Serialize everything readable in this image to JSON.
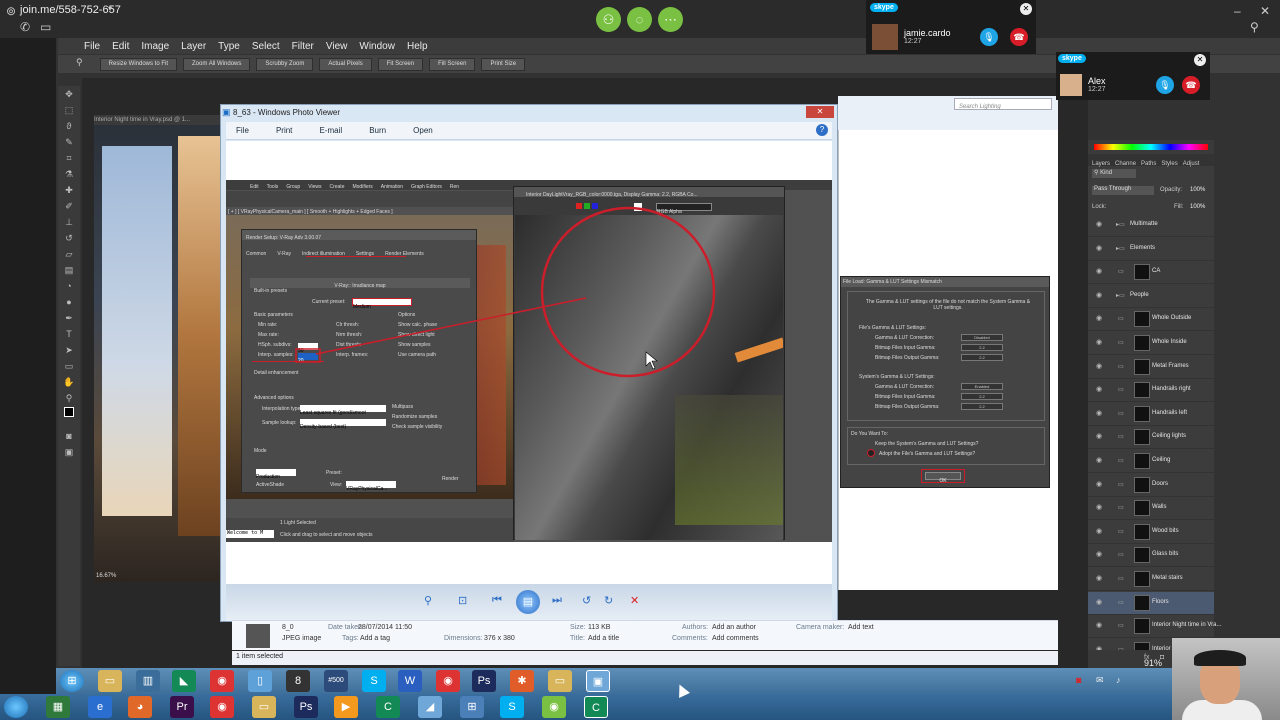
{
  "joinme": {
    "url": "join.me/558-752-657"
  },
  "photoshop": {
    "logo": "Ps",
    "menu": [
      "File",
      "Edit",
      "Image",
      "Layer",
      "Type",
      "Select",
      "Filter",
      "View",
      "Window",
      "Help"
    ],
    "options": [
      "Resize Windows to Fit",
      "Zoom All Windows",
      "Scrubby Zoom",
      "Actual Pixels",
      "Fit Screen",
      "Fill Screen",
      "Print Size"
    ],
    "doc_title": "Interior Night time in Vray.psd @ 1...",
    "zoom": "16.67%",
    "search_placeholder": "Search Lighting",
    "panel_tabs": [
      "Layers",
      "Channe",
      "Paths",
      "Styles",
      "Adjust"
    ],
    "kind_label": "Kind",
    "blend_mode": "Pass Through",
    "opacity_label": "Opacity:",
    "opacity_value": "100%",
    "lock_label": "Lock:",
    "fill_label": "Fill:",
    "fill_value": "100%",
    "layers": [
      {
        "name": "Multimatte",
        "folder": true,
        "selected": false
      },
      {
        "name": "Elements",
        "folder": true,
        "selected": false
      },
      {
        "name": "CA",
        "folder": false,
        "selected": false
      },
      {
        "name": "People",
        "folder": true,
        "selected": false
      },
      {
        "name": "Whole Outside",
        "folder": false,
        "selected": false
      },
      {
        "name": "Whole Inside",
        "folder": false,
        "selected": false
      },
      {
        "name": "Metal Frames",
        "folder": false,
        "selected": false
      },
      {
        "name": "Handrails right",
        "folder": false,
        "selected": false
      },
      {
        "name": "Handrails left",
        "folder": false,
        "selected": false
      },
      {
        "name": "Ceiling lights",
        "folder": false,
        "selected": false
      },
      {
        "name": "Ceiling",
        "folder": false,
        "selected": false
      },
      {
        "name": "Doors",
        "folder": false,
        "selected": false
      },
      {
        "name": "Walls",
        "folder": false,
        "selected": false
      },
      {
        "name": "Wood bits",
        "folder": false,
        "selected": false
      },
      {
        "name": "Glass bits",
        "folder": false,
        "selected": false
      },
      {
        "name": "Metal stairs",
        "folder": false,
        "selected": false
      },
      {
        "name": "Floors",
        "folder": false,
        "selected": true
      },
      {
        "name": "Interior Night time in Vra...",
        "folder": false,
        "selected": false
      },
      {
        "name": "Interior Night time in Vra...",
        "folder": false,
        "selected": false
      }
    ],
    "zoom_readout": "91%"
  },
  "photo_viewer": {
    "title": "8_63 - Windows Photo Viewer",
    "menu": [
      "File",
      "Print",
      "E-mail",
      "Burn",
      "Open"
    ]
  },
  "max": {
    "menu": [
      "Edit",
      "Tools",
      "Group",
      "Views",
      "Create",
      "Modifiers",
      "Animation",
      "Graph Editors",
      "Ren"
    ],
    "viewport_label": "[ + ] [ VRayPhysicalCamera_main ] [ Smooth + Highlights + Edged Faces ]",
    "status_selected": "1 Light Selected",
    "status_hint": "Click and drag to select and move objects",
    "welcome": "Welcome to M"
  },
  "render_setup": {
    "title": "Render Setup: V-Ray Adv 3.00.07",
    "tabs": [
      "Common",
      "V-Ray",
      "Indirect illumination",
      "Settings",
      "Render Elements"
    ],
    "rollout": "V-Ray:: Irradiance map",
    "built_in_presets": "Built-in presets",
    "current_preset_label": "Current preset:",
    "current_preset": "Medium",
    "basic_params": "Basic parameters",
    "options": "Options",
    "params_left": [
      "Min rate:",
      "Max rate:",
      "HSph. subdivs:",
      "Interp. samples:"
    ],
    "params_right": [
      "Clr thresh:",
      "Nrm thresh:",
      "Dist thresh:",
      "Interp. frames:"
    ],
    "options_list": [
      "Show calc. phase",
      "Show direct light",
      "Show samples",
      "Use camera path"
    ],
    "hsph_value": "50",
    "interp_value": "20",
    "detail": "Detail enhancement",
    "advanced": "Advanced options",
    "interpolation_label": "Interpolation type:",
    "interpolation": "Least squares fit (good/smoot",
    "sample_lookup_label": "Sample lookup:",
    "sample_lookup": "Density-based (best)",
    "adv_options": [
      "Multipass",
      "Randomize samples",
      "Check sample visibility"
    ],
    "mode": "Mode",
    "production": "Production",
    "activeshade": "ActiveShade",
    "preset_label": "Preset:",
    "view_label": "View:",
    "view_value": "VRayPhysicalCa...",
    "render_btn": "Render"
  },
  "vfb": {
    "title": "Interior DayLightVray_RGB_color:0000.tga, Display Gamma: 2.2, RGBA Co...",
    "channel": "RGB Alpha"
  },
  "gamma_dialog": {
    "title": "File Load: Gamma & LUT Settings Mismatch",
    "message": "The Gamma & LUT settings of the file do not match the System Gamma & LUT settings.",
    "file_section": "File's Gamma & LUT Settings:",
    "system_section": "System's Gamma & LUT Settings:",
    "rows": [
      "Gamma & LUT Correction:",
      "Bitmap Files Input Gamma:",
      "Bitmap Files Output Gamma:"
    ],
    "file_values": [
      "Disabled",
      "2.2",
      "2.2"
    ],
    "system_values": [
      "Enabled",
      "2.2",
      "2.2"
    ],
    "question": "Do You Want To:",
    "opt_keep": "Keep the System's Gamma and LUT Settings?",
    "opt_adopt": "Adopt the File's Gamma and LUT Settings?",
    "ok": "OK"
  },
  "details": {
    "filename": "8_0",
    "filetype": "JPEG image",
    "date_taken_k": "Date taken:",
    "date_taken_v": "28/07/2014 11:50",
    "tags_k": "Tags:",
    "tags_v": "Add a tag",
    "dimensions_k": "Dimensions:",
    "dimensions_v": "376 x 380",
    "size_k": "Size:",
    "size_v": "113 KB",
    "title_k": "Title:",
    "title_v": "Add a title",
    "authors_k": "Authors:",
    "authors_v": "Add an author",
    "comments_k": "Comments:",
    "comments_v": "Add comments",
    "camera_k": "Camera maker:",
    "camera_v": "Add text",
    "status": "1 item selected"
  },
  "skype": {
    "brand": "skype",
    "caller1": "jamie.cardo",
    "time1": "12:27",
    "caller2": "Alex",
    "time2": "12:27"
  },
  "taskbar_badges": {
    "counter": "8",
    "bbc": "#500"
  },
  "colors": {
    "accent_red": "#cc1e2a",
    "skype_blue": "#00aff0",
    "joinme_green": "#7ac143"
  }
}
